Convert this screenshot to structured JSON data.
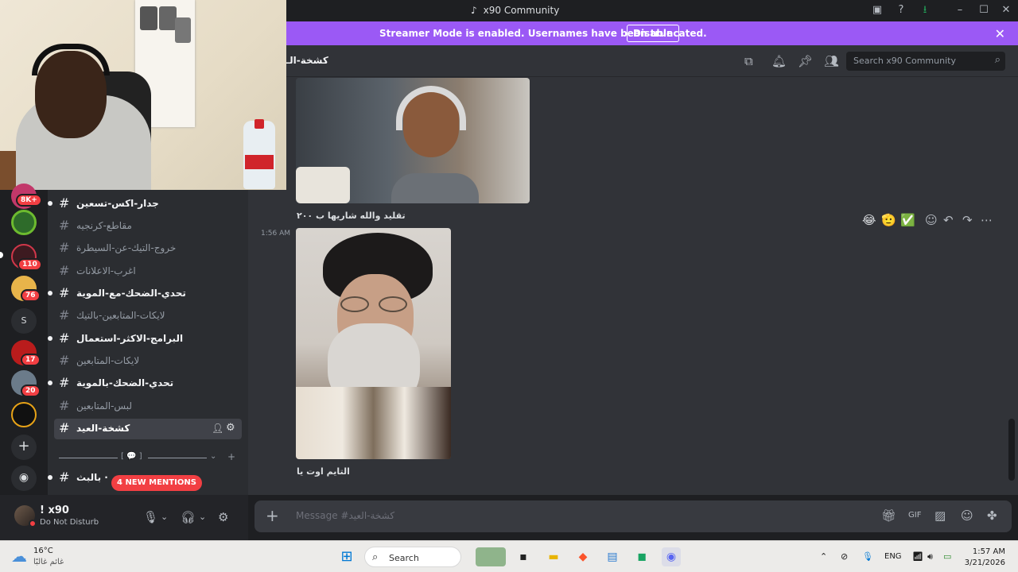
{
  "window": {
    "title": "x90 Community"
  },
  "banner": {
    "message": "Streamer Mode is enabled. Usernames have been truncated.",
    "button": "Disable"
  },
  "servers": [
    {
      "badge": "8K+"
    },
    {
      "badge": ""
    },
    {
      "badge": "110"
    },
    {
      "badge": "76"
    },
    {
      "letter": "S",
      "badge": ""
    },
    {
      "badge": "17"
    },
    {
      "badge": "20"
    },
    {
      "badge": ""
    }
  ],
  "sidebar": {
    "channels": [
      {
        "name": "جدار-اكس-تسعين",
        "unread": true
      },
      {
        "name": "مقاطع-كرنجيه",
        "unread": false
      },
      {
        "name": "خروج-التيك-عن-السيطرة",
        "unread": false
      },
      {
        "name": "اغرب-الاعلانات",
        "unread": false
      },
      {
        "name": "تحدي-الضحك-مع-الموية",
        "unread": true
      },
      {
        "name": "لايكات-المتابعين-بالتيك",
        "unread": false
      },
      {
        "name": "البرامج-الاكثر-استعمال",
        "unread": true
      },
      {
        "name": "لايكات-المتابعين",
        "unread": false
      },
      {
        "name": "تحدي-الضحك-بالموية",
        "unread": true
      },
      {
        "name": "لبس-المتابعين",
        "unread": false
      },
      {
        "name": "كشخة-العيد",
        "active": true
      }
    ],
    "category_glyph": "[ 💬 ]",
    "last_channel": "بالبث ·",
    "mentions": "4 NEW MENTIONS"
  },
  "user": {
    "name": "! x90",
    "status": "Do Not Disturb"
  },
  "header": {
    "channel": "كشخة-الـ",
    "search_placeholder": "Search x90 Community"
  },
  "messages": [
    {
      "text": "تقليد والله شاريها ب ٢٠٠"
    },
    {
      "time": "1:56 AM",
      "text": "التايم اوت يا"
    }
  ],
  "reactions": [
    "😂",
    "🫡",
    "✅"
  ],
  "composer": {
    "placeholder": "Message #كشخة-العيد"
  },
  "taskbar": {
    "temp": "16°C",
    "condition": "غائم غالبًا",
    "search": "Search",
    "lang": "ENG",
    "time": "1:57 AM",
    "date": "3/21/2026"
  },
  "colors": {
    "banner": "#9b59f5",
    "mention": "#f23f43",
    "bg": "#313338",
    "sidebar": "#2b2d31"
  }
}
